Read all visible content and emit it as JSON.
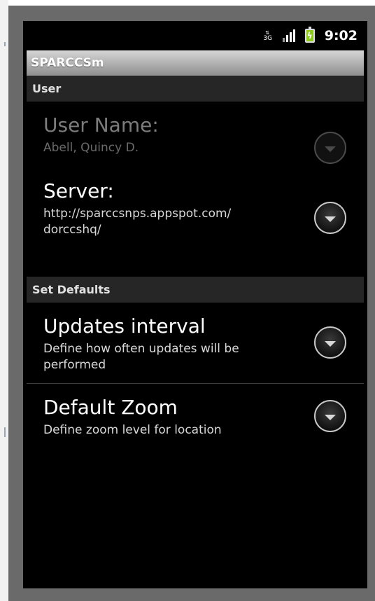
{
  "status_bar": {
    "network_type": "3G",
    "time": "9:02",
    "icons": [
      "data-activity-icon",
      "signal-strength-icon",
      "battery-charging-icon"
    ]
  },
  "app": {
    "title": "SPARCCSm"
  },
  "sections": [
    {
      "header": "User",
      "items": [
        {
          "title": "User Name:",
          "summary": "Abell, Quincy D.",
          "enabled": false,
          "icon": "dropdown-arrow-icon"
        },
        {
          "title": "Server:",
          "summary": "http://sparccsnps.appspot.com/\ndorccshq/",
          "enabled": true,
          "icon": "dropdown-arrow-icon"
        }
      ]
    },
    {
      "header": "Set Defaults",
      "items": [
        {
          "title": "Updates interval",
          "summary": "Define how often updates will be\nperformed",
          "enabled": true,
          "icon": "dropdown-arrow-icon"
        },
        {
          "title": "Default Zoom",
          "summary": "Define zoom level for location",
          "enabled": true,
          "icon": "dropdown-arrow-icon"
        }
      ]
    }
  ],
  "colors": {
    "screen_background": "#000000",
    "section_header_background": "#262626",
    "battery": "#8dcb1a",
    "disabled_text": "#7c7c7c"
  }
}
